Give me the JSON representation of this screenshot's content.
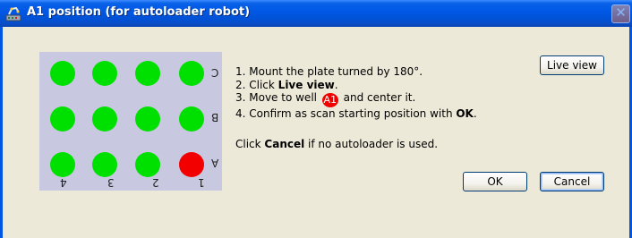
{
  "window": {
    "title": "A1 position (for autoloader robot)",
    "icons": {
      "app": "robot-arm-icon",
      "close": "close-icon"
    },
    "close_glyph": "✕"
  },
  "plate": {
    "row_labels": [
      "C",
      "B",
      "A"
    ],
    "column_labels": [
      "4",
      "3",
      "2",
      "1"
    ],
    "colors": {
      "well": "#00E000",
      "highlight_well": "#F20000",
      "plate": "#C8C8E0"
    },
    "highlighted_well": "A1"
  },
  "instructions": {
    "step1": "1. Mount the plate turned by 180°.",
    "step2_prefix": "2. Click ",
    "step2_bold": "Live view",
    "step2_suffix": ".",
    "step3_prefix": "3. Move to well ",
    "step3_badge": "A1",
    "step3_suffix": " and center it.",
    "step4_prefix": "4. Confirm as scan starting position with ",
    "step4_bold": "OK",
    "step4_suffix": "."
  },
  "note": {
    "prefix": "Click ",
    "bold": "Cancel",
    "suffix": " if no autoloader is used."
  },
  "buttons": {
    "live_view": "Live view",
    "ok": "OK",
    "cancel": "Cancel"
  }
}
